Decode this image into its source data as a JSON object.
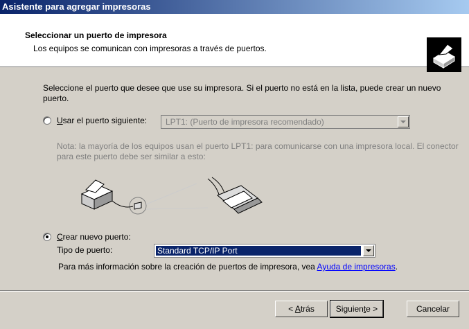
{
  "window": {
    "title": "Asistente para agregar impresoras"
  },
  "header": {
    "title": "Seleccionar un puerto de impresora",
    "subtitle": "Los equipos se comunican con impresoras a través de puertos.",
    "icon": "printer-icon"
  },
  "main": {
    "instruction": "Seleccione el puerto que desee que use su impresora. Si el puerto no está en la lista, puede crear un nuevo puerto.",
    "use_port": {
      "label_prefix": "",
      "label_mnemonic": "U",
      "label_rest": "sar el puerto siguiente:",
      "selected": false,
      "combo_value": "LPT1: (Puerto de impresora recomendado)"
    },
    "note": "Nota: la mayoría de los equipos usan el puerto LPT1: para comunicarse con una impresora local. El conector para este puerto debe ser similar a esto:",
    "create_port": {
      "label_mnemonic": "C",
      "label_rest": "rear nuevo puerto:",
      "selected": true,
      "type_label": "Tipo de puerto:",
      "type_value": "Standard TCP/IP Port"
    },
    "info_text": "Para más información sobre la creación de puertos de impresora, vea ",
    "info_link": "Ayuda de impresoras",
    "info_end": "."
  },
  "buttons": {
    "back_prefix": "< ",
    "back_mnemonic": "A",
    "back_rest": "trás",
    "next_prefix": "Siguien",
    "next_mnemonic": "t",
    "next_rest": "e >",
    "cancel": "Cancelar"
  }
}
